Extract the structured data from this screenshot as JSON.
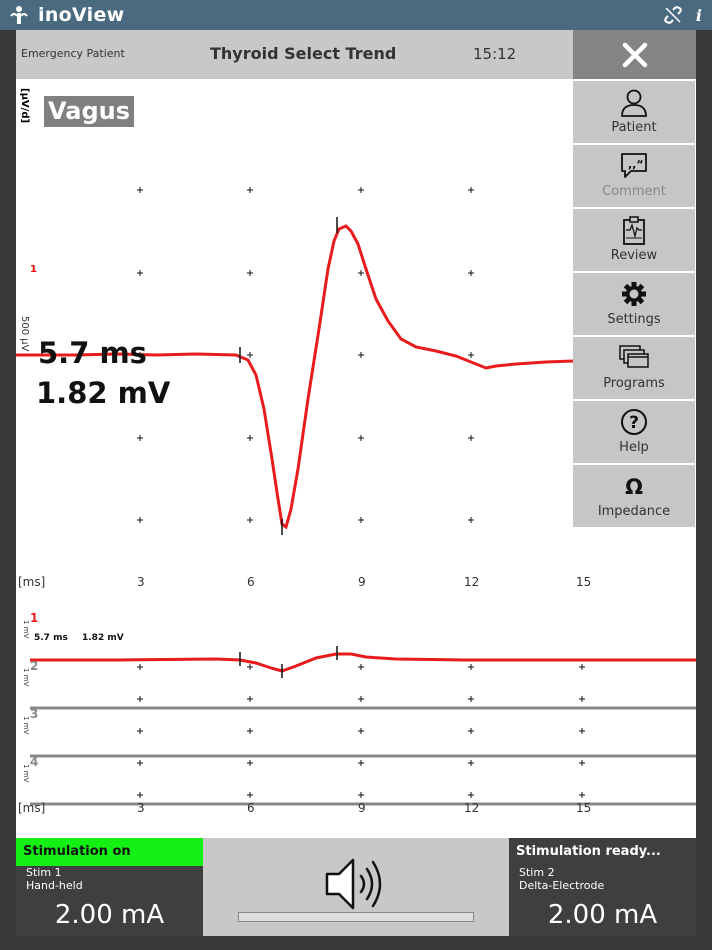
{
  "app": {
    "title": "inoView",
    "logo_icon": "neuro-logo-icon",
    "link_icon": "unlink-icon",
    "info_icon": "info-icon"
  },
  "header": {
    "patient": "Emergency Patient",
    "title": "Thyroid Select Trend",
    "time": "15:12"
  },
  "menu": [
    {
      "label": "Patient",
      "icon": "person-icon",
      "enabled": true
    },
    {
      "label": "Comment",
      "icon": "comment-icon",
      "enabled": false
    },
    {
      "label": "Review",
      "icon": "clipboard-wave-icon",
      "enabled": true
    },
    {
      "label": "Settings",
      "icon": "gear-icon",
      "enabled": true
    },
    {
      "label": "Programs",
      "icon": "stacked-windows-icon",
      "enabled": true
    },
    {
      "label": "Help",
      "icon": "question-icon",
      "enabled": true
    },
    {
      "label": "Impedance",
      "icon": "omega-icon",
      "enabled": true
    }
  ],
  "main_plot": {
    "channel_name": "Vagus",
    "unit": "[µV/d]",
    "channel_number": "1",
    "scale": "500 µV",
    "latency": "5.7 ms",
    "amplitude": "1.82 mV",
    "trace_color": "#e81c1c"
  },
  "axis": {
    "unit": "[ms]",
    "ticks": [
      "3",
      "6",
      "9",
      "12",
      "15"
    ]
  },
  "trend": {
    "channels": [
      {
        "number": "1",
        "scale": "1 mV",
        "color": "#e81c1c",
        "latency": "5.7 ms",
        "amplitude": "1.82 mV"
      },
      {
        "number": "2",
        "scale": "1 mV",
        "color": "#888888"
      },
      {
        "number": "3",
        "scale": "1 mV",
        "color": "#888888"
      },
      {
        "number": "4",
        "scale": "1 mV",
        "color": "#888888"
      }
    ]
  },
  "stim1": {
    "status": "Stimulation on",
    "name": "Stim 1",
    "electrode": "Hand-held",
    "current": "2.00 mA",
    "status_color": "#14f014"
  },
  "stim2": {
    "status": "Stimulation ready...",
    "name": "Stim 2",
    "electrode": "Delta-Electrode",
    "current": "2.00 mA"
  },
  "sound": {
    "icon": "speaker-icon"
  }
}
